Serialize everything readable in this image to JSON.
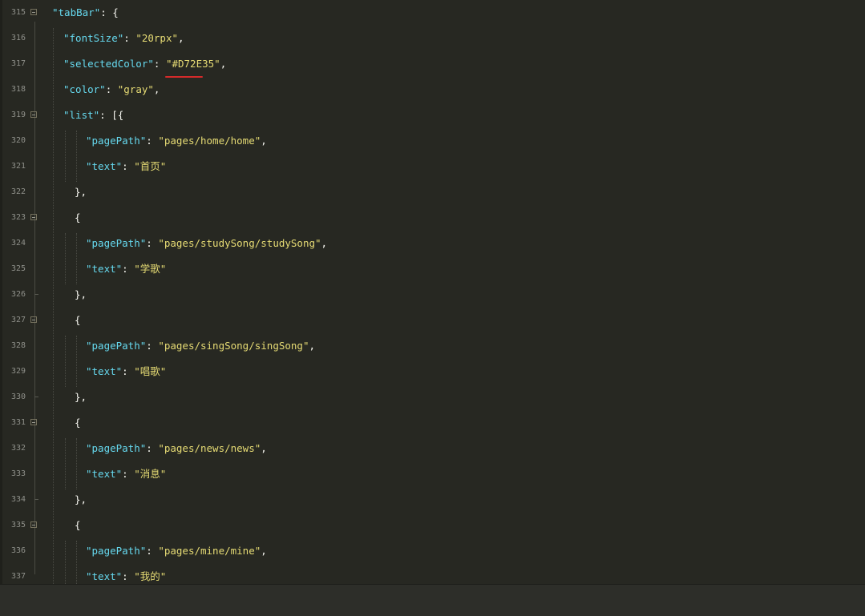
{
  "editor": {
    "lines": [
      {
        "num": "315",
        "key": "\"tabBar\"",
        "sep": ": ",
        "val": "",
        "tail": "{"
      },
      {
        "num": "316",
        "key": "\"fontSize\"",
        "sep": ": ",
        "val": "\"20rpx\"",
        "tail": ","
      },
      {
        "num": "317",
        "key": "\"selectedColor\"",
        "sep": ": ",
        "val": "\"#D72E35\"",
        "tail": ","
      },
      {
        "num": "318",
        "key": "\"color\"",
        "sep": ": ",
        "val": "\"gray\"",
        "tail": ","
      },
      {
        "num": "319",
        "key": "\"list\"",
        "sep": ": ",
        "val": "",
        "tail": "[{"
      },
      {
        "num": "320",
        "key": "\"pagePath\"",
        "sep": ": ",
        "val": "\"pages/home/home\"",
        "tail": ","
      },
      {
        "num": "321",
        "key": "\"text\"",
        "sep": ": ",
        "val": "\"首页\"",
        "tail": ""
      },
      {
        "num": "322",
        "key": "",
        "sep": "",
        "val": "",
        "tail": "},"
      },
      {
        "num": "323",
        "key": "",
        "sep": "",
        "val": "",
        "tail": "{"
      },
      {
        "num": "324",
        "key": "\"pagePath\"",
        "sep": ": ",
        "val": "\"pages/studySong/studySong\"",
        "tail": ","
      },
      {
        "num": "325",
        "key": "\"text\"",
        "sep": ": ",
        "val": "\"学歌\"",
        "tail": ""
      },
      {
        "num": "326",
        "key": "",
        "sep": "",
        "val": "",
        "tail": "},"
      },
      {
        "num": "327",
        "key": "",
        "sep": "",
        "val": "",
        "tail": "{"
      },
      {
        "num": "328",
        "key": "\"pagePath\"",
        "sep": ": ",
        "val": "\"pages/singSong/singSong\"",
        "tail": ","
      },
      {
        "num": "329",
        "key": "\"text\"",
        "sep": ": ",
        "val": "\"唱歌\"",
        "tail": ""
      },
      {
        "num": "330",
        "key": "",
        "sep": "",
        "val": "",
        "tail": "},"
      },
      {
        "num": "331",
        "key": "",
        "sep": "",
        "val": "",
        "tail": "{"
      },
      {
        "num": "332",
        "key": "\"pagePath\"",
        "sep": ": ",
        "val": "\"pages/news/news\"",
        "tail": ","
      },
      {
        "num": "333",
        "key": "\"text\"",
        "sep": ": ",
        "val": "\"消息\"",
        "tail": ""
      },
      {
        "num": "334",
        "key": "",
        "sep": "",
        "val": "",
        "tail": "},"
      },
      {
        "num": "335",
        "key": "",
        "sep": "",
        "val": "",
        "tail": "{"
      },
      {
        "num": "336",
        "key": "\"pagePath\"",
        "sep": ": ",
        "val": "\"pages/mine/mine\"",
        "tail": ","
      },
      {
        "num": "337",
        "key": "\"text\"",
        "sep": ": ",
        "val": "\"我的\"",
        "tail": ""
      }
    ]
  },
  "colors": {
    "background": "#272822",
    "key": "#66d9ef",
    "string": "#e6db74",
    "punctuation": "#f8f8f2",
    "line_number": "#8f908a",
    "error_underline": "#d42a2a",
    "status_bar": "#2d2e29"
  }
}
